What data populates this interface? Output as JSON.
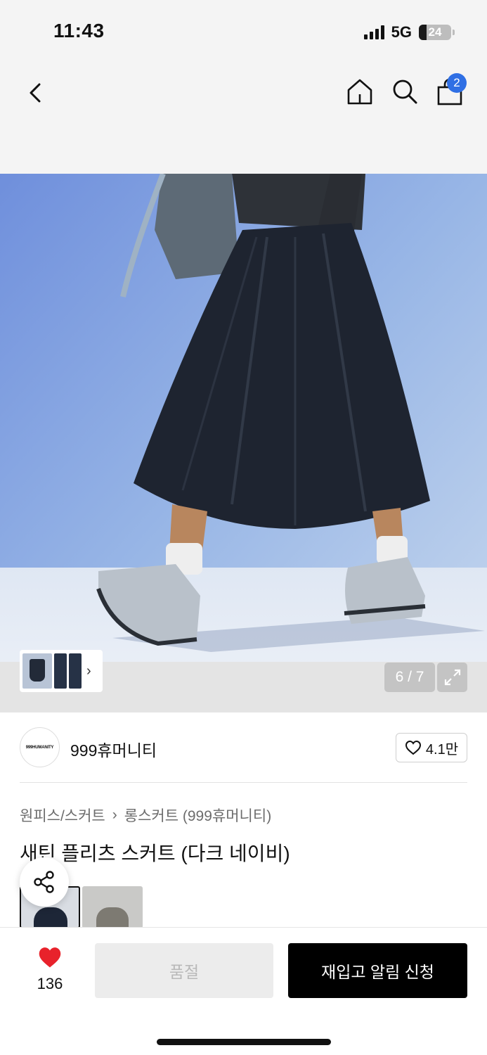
{
  "status_bar": {
    "time": "11:43",
    "network": "5G",
    "battery": "24",
    "battery_level": 0.24
  },
  "nav": {
    "back_icon": "chevron-left-icon",
    "home_icon": "home-icon",
    "search_icon": "search-icon",
    "cart_icon": "shopping-bag-icon",
    "cart_count": "2",
    "badge_color": "#2f6fe4"
  },
  "gallery": {
    "counter": "6 / 7",
    "thumb_arrow": "›",
    "expand_icon": "expand-icon"
  },
  "brand": {
    "logo_text": "999HUMANITY",
    "name": "999휴머니티",
    "like_count": "4.1만"
  },
  "product": {
    "breadcrumb": [
      "원피스/스커트",
      "롱스커트 (999휴머니티)"
    ],
    "breadcrumb_separator": "›",
    "title": "새틴 플리츠 스커트 (다크 네이비)"
  },
  "bottom": {
    "wish_count": "136",
    "soldout_label": "품절",
    "restock_label": "재입고 알림 신청",
    "heart_color": "#e8222b"
  }
}
